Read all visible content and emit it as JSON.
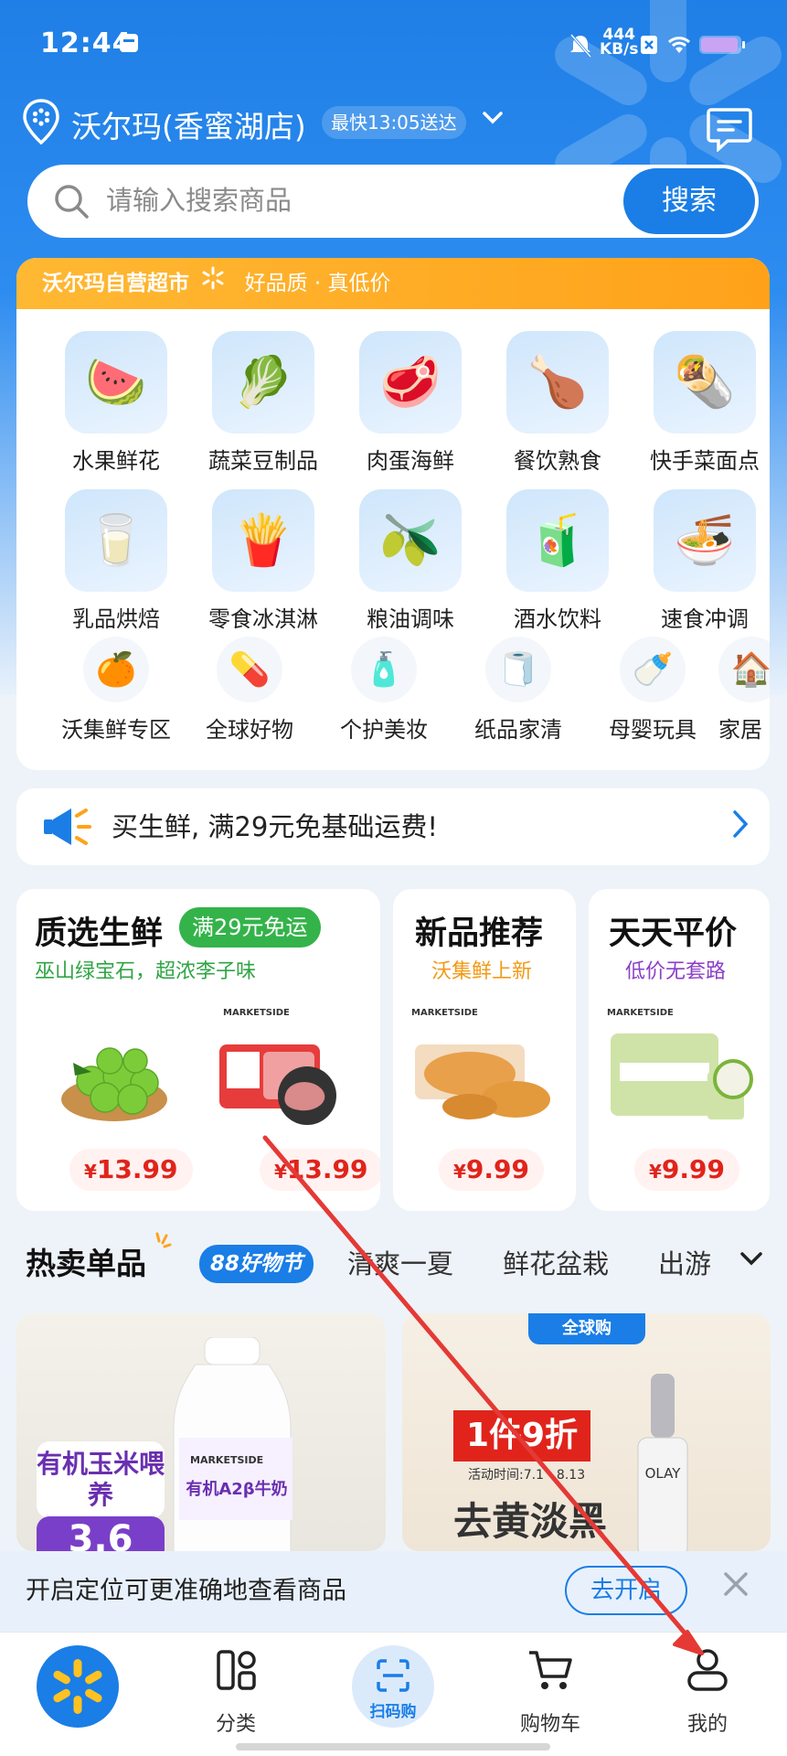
{
  "status_bar": {
    "time": "12:44",
    "net_speed_top": "444",
    "net_speed_unit": "KB/s"
  },
  "header": {
    "store_name": "沃尔玛(香蜜湖店)",
    "delivery": "最快13:05送达"
  },
  "search": {
    "placeholder": "请输入搜索商品",
    "button": "搜索"
  },
  "category_band": {
    "brand": "沃尔玛自营超市",
    "slogan": "好品质 · 真低价"
  },
  "categories_row1": [
    {
      "label": "水果鲜花",
      "icon": "watermelon-icon"
    },
    {
      "label": "蔬菜豆制品",
      "icon": "lettuce-icon"
    },
    {
      "label": "肉蛋海鲜",
      "icon": "meat-icon"
    },
    {
      "label": "餐饮熟食",
      "icon": "fried-food-icon"
    },
    {
      "label": "快手菜面点",
      "icon": "burrito-icon"
    }
  ],
  "categories_row2": [
    {
      "label": "乳品烘焙",
      "icon": "milk-icon"
    },
    {
      "label": "零食冰淇淋",
      "icon": "snack-icon"
    },
    {
      "label": "粮油调味",
      "icon": "oil-icon"
    },
    {
      "label": "酒水饮料",
      "icon": "drink-icon"
    },
    {
      "label": "速食冲调",
      "icon": "instant-food-icon"
    }
  ],
  "categories_row3": [
    {
      "label": "沃集鲜专区",
      "icon": "fresh-zone-icon"
    },
    {
      "label": "全球好物",
      "icon": "global-goods-icon"
    },
    {
      "label": "个护美妆",
      "icon": "lotion-icon"
    },
    {
      "label": "纸品家清",
      "icon": "tissue-icon"
    },
    {
      "label": "母婴玩具",
      "icon": "baby-formula-icon"
    },
    {
      "label": "家居",
      "icon": "home-goods-icon"
    }
  ],
  "notice": {
    "text": "买生鲜, 满29元免基础运费!"
  },
  "promo": {
    "fresh": {
      "title": "质选生鲜",
      "tag": "满29元免运",
      "subtitle": "巫山绿宝石，超浓李子味",
      "price1": "13.99",
      "price2": "13.99"
    },
    "new": {
      "title": "新品推荐",
      "subtitle": "沃集鲜上新",
      "price": "9.99"
    },
    "daily": {
      "title": "天天平价",
      "subtitle": "低价无套路",
      "price": "9.99"
    },
    "currency": "¥",
    "brand_mark": "MARKETSIDE"
  },
  "tabs": [
    {
      "label": "热卖单品"
    },
    {
      "label": "88好物节"
    },
    {
      "label": "清爽一夏"
    },
    {
      "label": "鲜花盆栽"
    },
    {
      "label": "出游"
    }
  ],
  "feed": {
    "left": {
      "headline": "有机玉米喂养",
      "price_partial": "3.6",
      "product": "有机A2β牛奶",
      "brand": "MARKETSIDE"
    },
    "right": {
      "badge": "全球购",
      "discount": "1件9折",
      "date": "活动时间:7.1 - 8.13",
      "headline": "去黄淡黑",
      "brand": "OLAY"
    }
  },
  "location_banner": {
    "text": "开启定位可更准确地查看商品",
    "button": "去开启"
  },
  "bottom_nav": {
    "category": "分类",
    "scan": "扫码购",
    "cart": "购物车",
    "mine": "我的"
  },
  "colors": {
    "primary": "#1a7ee6",
    "accent_orange": "#ffa21a",
    "price_red": "#e0241b",
    "green": "#34b34a",
    "annotation": "#e53935"
  }
}
